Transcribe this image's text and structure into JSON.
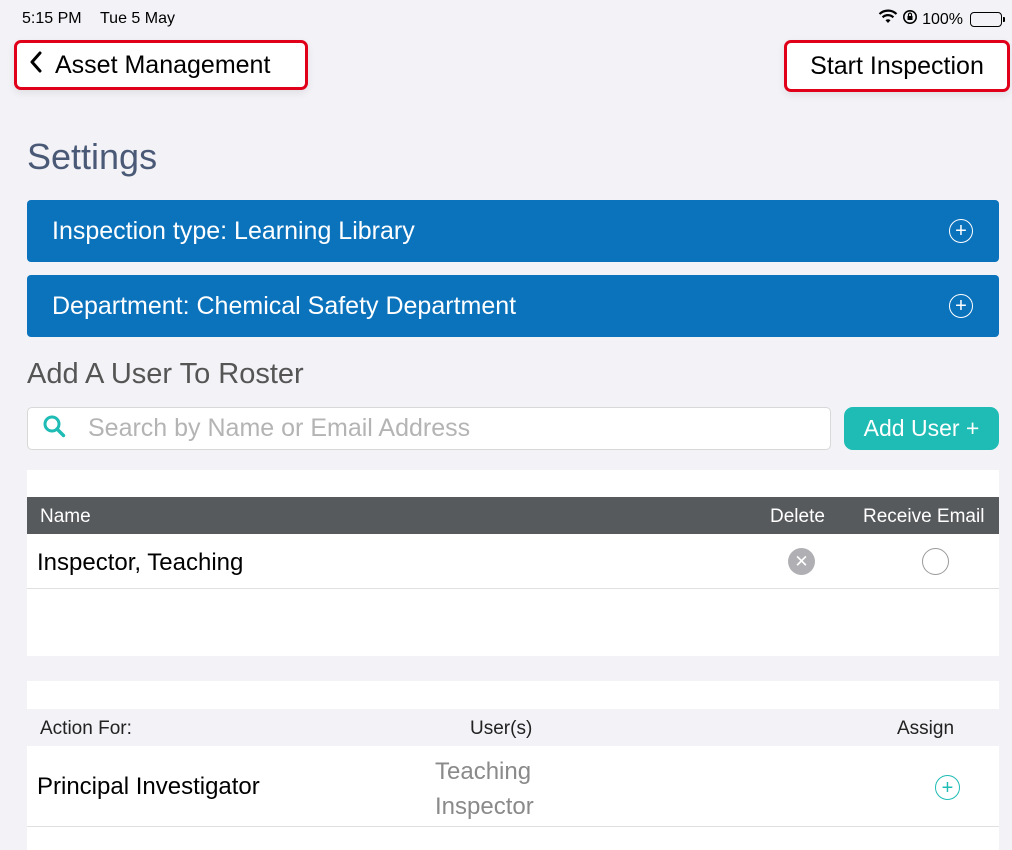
{
  "status_bar": {
    "time": "5:15 PM",
    "date": "Tue 5 May",
    "battery": "100%",
    "icons": [
      "wifi-icon",
      "orientation-lock-icon",
      "battery-icon"
    ]
  },
  "nav": {
    "back_label": "Asset Management",
    "start_label": "Start Inspection"
  },
  "page": {
    "title": "Settings"
  },
  "bars": {
    "inspection_type": "Inspection type: Learning Library",
    "department": "Department: Chemical Safety Department"
  },
  "roster": {
    "title": "Add A User To Roster",
    "search_placeholder": "Search by Name or Email Address",
    "add_user_label": "Add User +",
    "columns": {
      "name": "Name",
      "delete": "Delete",
      "receive_email": "Receive Email"
    },
    "rows": [
      {
        "name": "Inspector,  Teaching",
        "receive_email": false
      }
    ]
  },
  "actions": {
    "columns": {
      "action_for": "Action For:",
      "users": "User(s)",
      "assign": "Assign"
    },
    "rows": [
      {
        "role": "Principal Investigator",
        "users": "Teaching Inspector"
      }
    ]
  },
  "colors": {
    "bar_blue": "#0b72bc",
    "teal": "#1ebcb4",
    "highlight_red": "#e1001a",
    "title_slate": "#4a5a76",
    "header_gray": "#575a5d"
  }
}
